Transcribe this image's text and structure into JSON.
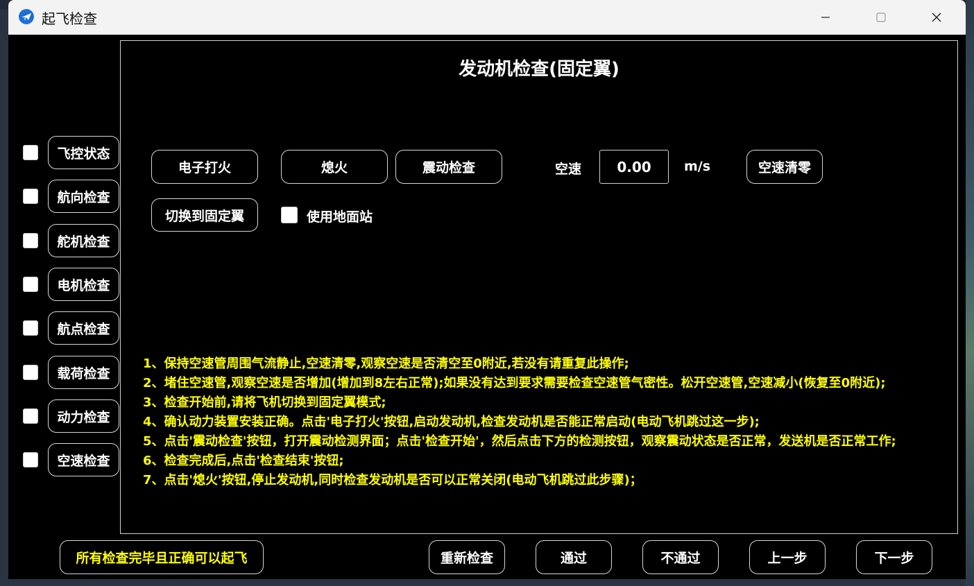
{
  "window": {
    "title": "起飞检查"
  },
  "sidebar": {
    "items": [
      {
        "label": "飞控状态",
        "checked": false
      },
      {
        "label": "航向检查",
        "checked": false
      },
      {
        "label": "舵机检查",
        "checked": false
      },
      {
        "label": "电机检查",
        "checked": false
      },
      {
        "label": "航点检查",
        "checked": false
      },
      {
        "label": "载荷检查",
        "checked": false
      },
      {
        "label": "动力检查",
        "checked": false
      },
      {
        "label": "空速检查",
        "checked": false
      }
    ]
  },
  "panel": {
    "title": "发动机检查(固定翼)",
    "buttons": {
      "ignite": "电子打火",
      "stop": "熄火",
      "vibration": "震动检查",
      "airspeed_zero": "空速清零",
      "switch_fixed_wing": "切换到固定翼"
    },
    "airspeed": {
      "label": "空速",
      "value": "0.00",
      "unit": "m/s"
    },
    "ground_station": {
      "label": "使用地面站",
      "checked": false
    },
    "instructions": [
      "1、保持空速管周围气流静止,空速清零,观察空速是否清空至0附近,若没有请重复此操作;",
      "2、堵住空速管,观察空速是否增加(增加到8左右正常);如果没有达到要求需要检查空速管气密性。松开空速管,空速减小(恢复至0附近);",
      "3、检查开始前,请将飞机切换到固定翼模式;",
      "4、确认动力装置安装正确。点击'电子打火'按钮,启动发动机,检查发动机是否能正常启动(电动飞机跳过这一步);",
      "5、点击'震动检查'按钮，打开震动检测界面；点击'检查开始'，然后点击下方的检测按钮，观察震动状态是否正常，发送机是否正常工作;",
      "6、检查完成后,点击'检查结束'按钮;",
      "7、点击'熄火'按钮,停止发动机,同时检查发动机是否可以正常关闭(电动飞机跳过此步骤)；"
    ]
  },
  "footer": {
    "all_done": "所有检查完毕且正确可以起飞",
    "recheck": "重新检查",
    "pass": "通过",
    "fail": "不通过",
    "prev": "上一步",
    "next": "下一步"
  },
  "colors": {
    "accent_text": "#ffff00",
    "background": "#000000",
    "titlebar": "#f3f3f3"
  }
}
